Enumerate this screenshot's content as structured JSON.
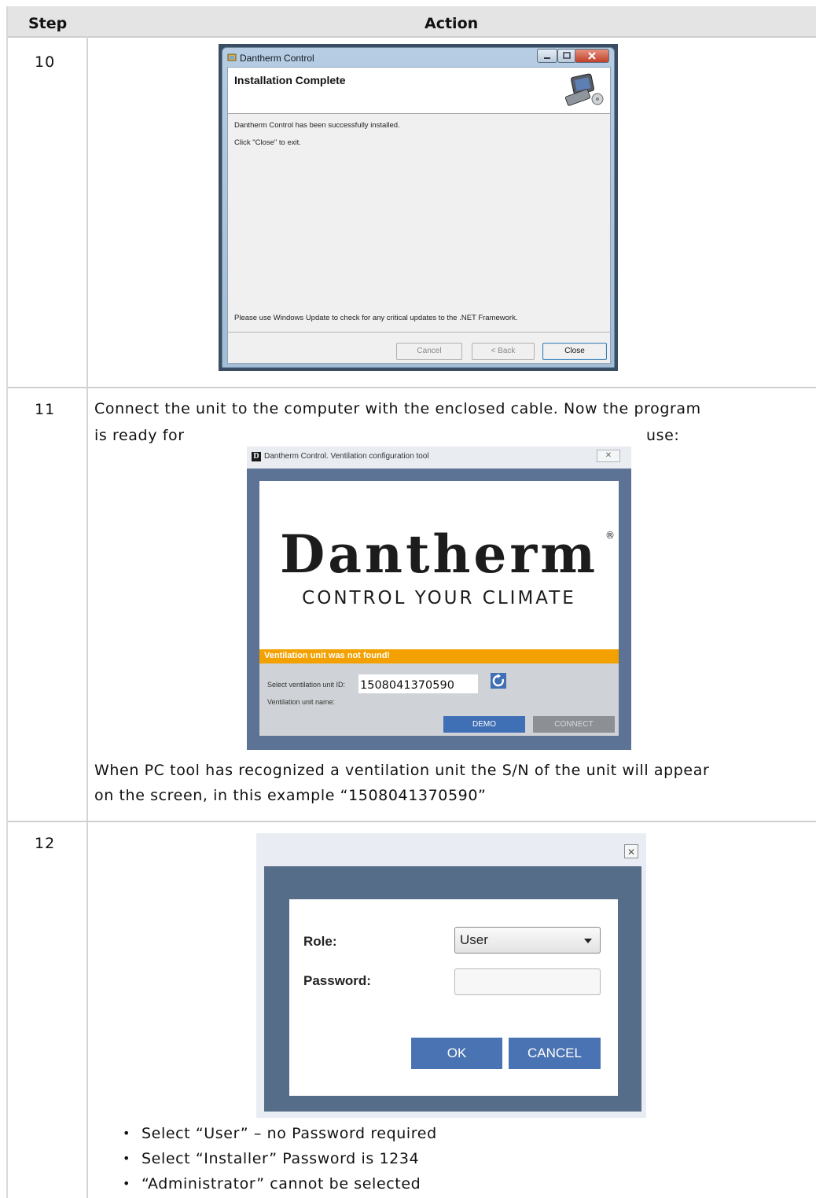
{
  "table": {
    "header": {
      "step": "Step",
      "action": "Action"
    }
  },
  "step10": {
    "number": "10",
    "window": {
      "title": "Dantherm Control",
      "heading": "Installation Complete",
      "line1": "Dantherm Control has been successfully installed.",
      "line2": "Click \"Close\" to exit.",
      "line3": "Please use Windows Update to check for any critical updates to the .NET Framework.",
      "cancel": "Cancel",
      "back": "< Back",
      "close": "Close"
    }
  },
  "step11": {
    "number": "11",
    "text_line1": "Connect the unit to the computer with the enclosed cable. Now the program",
    "text_line2a": "is ready for",
    "text_line2b": "use:",
    "window": {
      "title": "Dantherm Control. Ventilation configuration tool",
      "close_glyph": "✕",
      "logo": "Dantherm",
      "registered": "®",
      "tagline": "CONTROL YOUR CLIMATE",
      "warning": "Ventilation unit was not found!",
      "select_label": "Select ventilation unit ID:",
      "unit_id": "1508041370590",
      "name_label": "Ventilation unit name:",
      "demo": "DEMO",
      "connect": "CONNECT"
    },
    "after_line1": "When PC tool has recognized a ventilation unit the S/N of the unit will appear",
    "after_line2": "on the screen, in this example “1508041370590”"
  },
  "step12": {
    "number": "12",
    "window": {
      "close_glyph": "✕",
      "role_label": "Role:",
      "role_value": "User",
      "password_label": "Password:",
      "password_value": "",
      "ok": "OK",
      "cancel": "CANCEL"
    },
    "bullets": [
      "Select “User” – no Password required",
      "Select “Installer” Password is 1234",
      "“Administrator” cannot be selected"
    ]
  },
  "colors": {
    "header_bg": "#e4e4e4",
    "warning_bar": "#f2a100",
    "button_blue": "#4a73b3",
    "dialog_frame": "#566d8a"
  }
}
